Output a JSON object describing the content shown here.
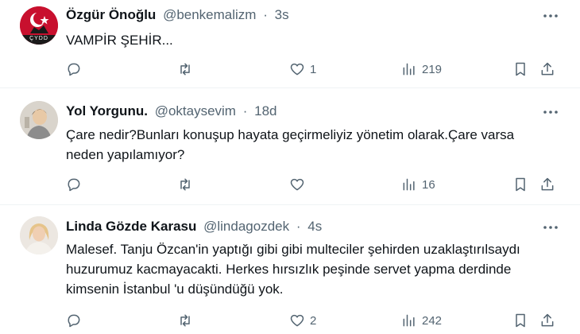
{
  "tweets": [
    {
      "name": "Özgür Önoğlu",
      "handle": "@benkemalizm",
      "separator": "·",
      "time": "3s",
      "text": "VAMPİR ŞEHİR...",
      "replies": "",
      "retweets": "",
      "likes": "1",
      "views": "219",
      "avatar_text": "ÇYDD"
    },
    {
      "name": "Yol Yorgunu.",
      "handle": "@oktaysevim",
      "separator": "·",
      "time": "18d",
      "text": "Çare nedir?Bunları konuşup hayata geçirmeliyiz yönetim olarak.Çare varsa neden yapılamıyor?",
      "replies": "",
      "retweets": "",
      "likes": "",
      "views": "16"
    },
    {
      "name": "Linda Gözde Karasu",
      "handle": "@lindagozdek",
      "separator": "·",
      "time": "4s",
      "text": "Malesef. Tanju Özcan'in yaptığı gibi gibi multeciler şehirden uzaklaştırılsaydı huzurumuz kacmayacakti. Herkes hırsızlık peşinde servet yapma derdinde kimsenin İstanbul 'u düşündüğü yok.",
      "replies": "",
      "retweets": "",
      "likes": "2",
      "views": "242"
    }
  ],
  "colors": {
    "text_primary": "#0f1419",
    "text_secondary": "#536471",
    "divider": "#eff3f4",
    "avatar1_red": "#c8102e"
  },
  "icons": [
    "reply-icon",
    "retweet-icon",
    "like-icon",
    "views-icon",
    "bookmark-icon",
    "share-icon",
    "more-icon"
  ]
}
